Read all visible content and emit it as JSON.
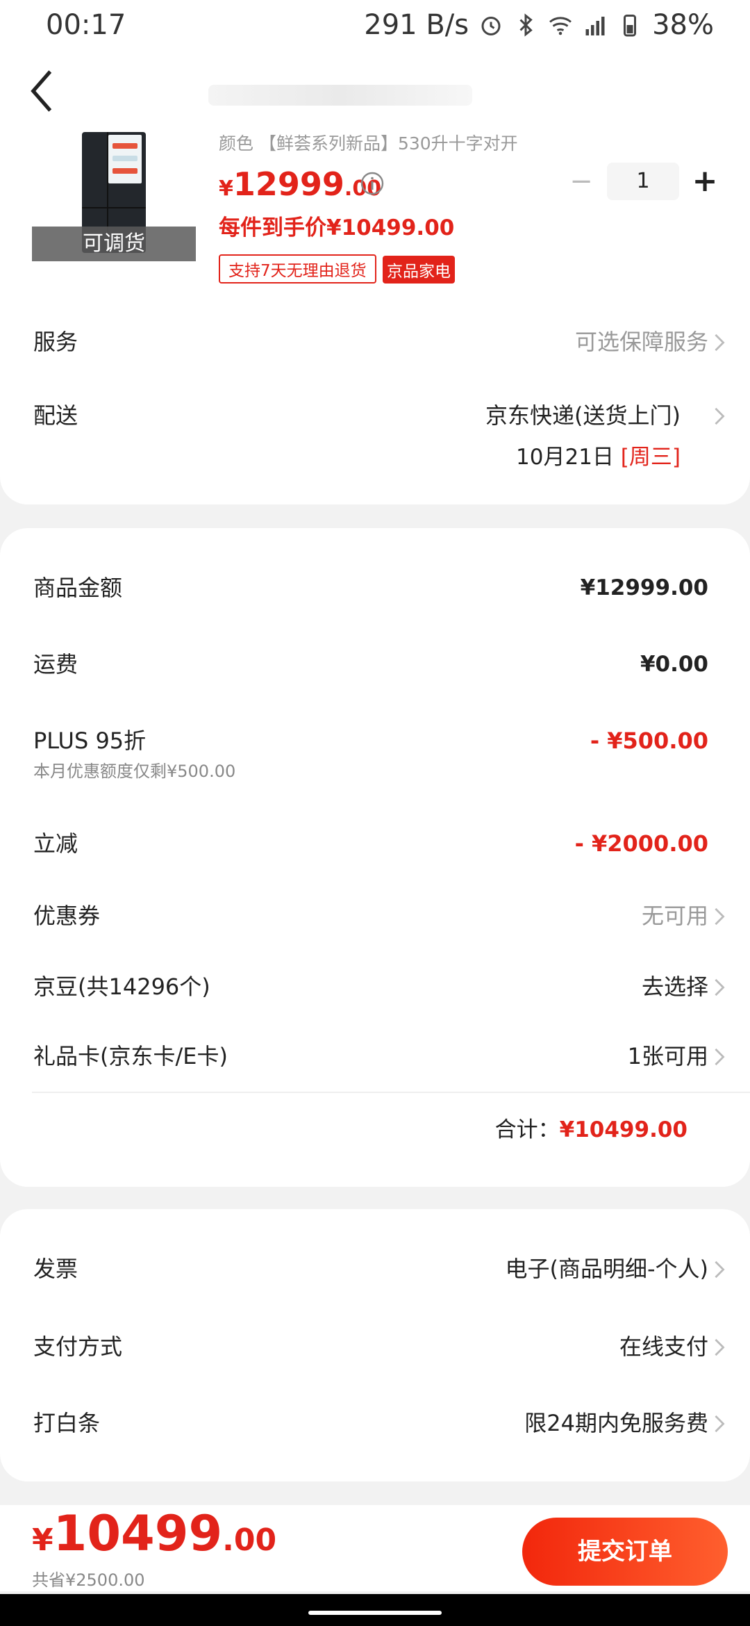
{
  "status_bar": {
    "time": "00:17",
    "net_speed": "291 B/s",
    "battery": "38%",
    "icons": [
      "alarm-icon",
      "bluetooth-icon",
      "wifi-icon",
      "signal-icon",
      "battery-icon"
    ]
  },
  "product": {
    "spec": "颜色 【鲜荟系列新品】530升十字对开",
    "image_badge": "可调货",
    "price_yen": "¥",
    "price_int": "12999",
    "price_dec": ".00",
    "daoshou_price": "每件到手价¥10499.00",
    "tag_return": "支持7天无理由退货",
    "tag_brand": "京品家电",
    "quantity": "1"
  },
  "service": {
    "label": "服务",
    "value": "可选保障服务"
  },
  "delivery": {
    "label": "配送",
    "value": "京东快递(送货上门)",
    "date": "10月21日 ",
    "weekday": "[周三]"
  },
  "summary": {
    "goods_label": "商品金额",
    "goods_value": "¥12999.00",
    "freight_label": "运费",
    "freight_value": "¥0.00",
    "plus_label": "PLUS 95折",
    "plus_sub": "本月优惠额度仅剩¥500.00",
    "plus_value": "- ¥500.00",
    "lijian_label": "立减",
    "lijian_value": "- ¥2000.00",
    "coupon_label": "优惠券",
    "coupon_value": "无可用",
    "jingdou_label": "京豆(共14296个)",
    "jingdou_value": "去选择",
    "giftcard_label": "礼品卡(京东卡/E卡)",
    "giftcard_value": "1张可用",
    "total_label": "合计：",
    "total_value": "¥10499.00"
  },
  "extra": {
    "invoice_label": "发票",
    "invoice_value": "电子(商品明细-个人)",
    "pay_label": "支付方式",
    "pay_value": "在线支付",
    "baitiao_label": "打白条",
    "baitiao_value": "限24期内免服务费"
  },
  "bottom": {
    "yen": "¥",
    "int": "10499",
    "dec": ".00",
    "saved": "共省¥2500.00",
    "submit": "提交订单"
  },
  "colors": {
    "accent": "#e2231a",
    "button_gradient_start": "#f2270c",
    "button_gradient_end": "#ff5f2e"
  }
}
